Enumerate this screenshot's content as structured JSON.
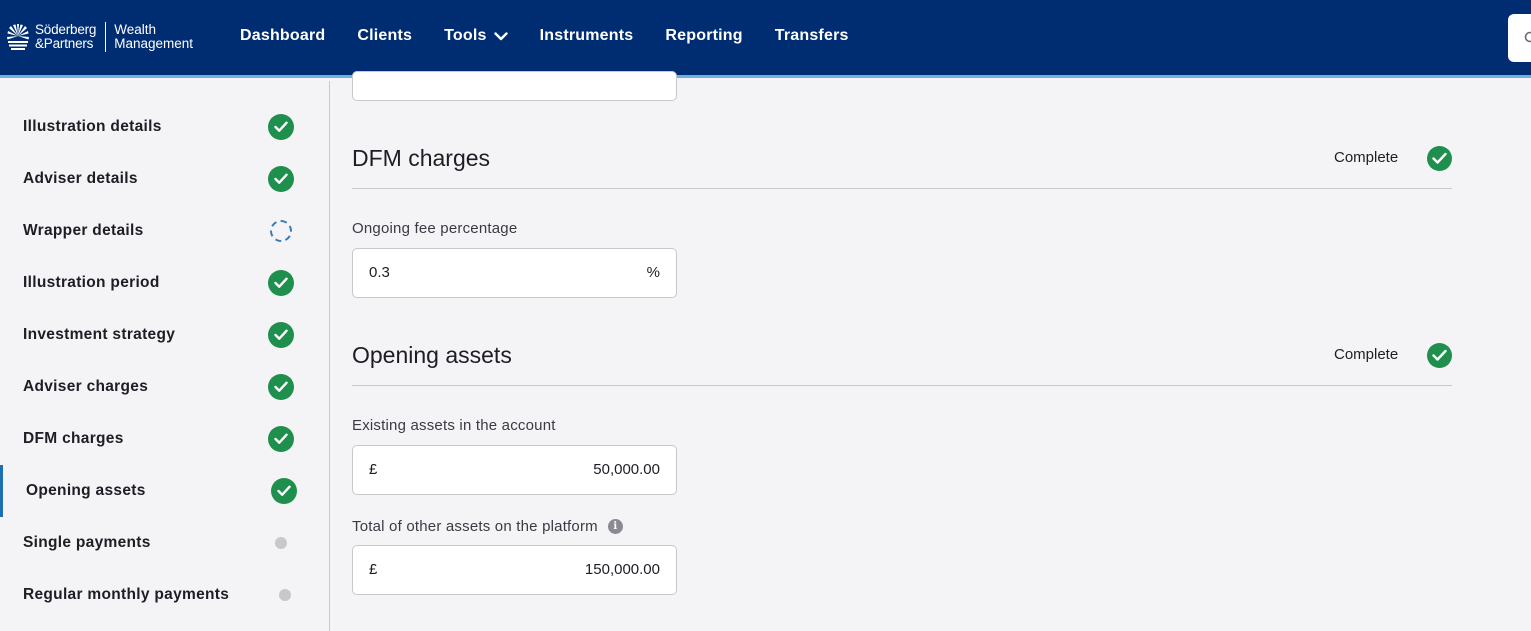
{
  "brand": {
    "name_line1": "Söderberg",
    "name_line2": "&Partners",
    "sub_line1": "Wealth",
    "sub_line2": "Management"
  },
  "nav": {
    "items": [
      {
        "label": "Dashboard"
      },
      {
        "label": "Clients"
      },
      {
        "label": "Tools"
      },
      {
        "label": "Instruments"
      },
      {
        "label": "Reporting"
      },
      {
        "label": "Transfers"
      }
    ]
  },
  "sidebar": {
    "items": [
      {
        "label": "Illustration details",
        "status": "complete"
      },
      {
        "label": "Adviser details",
        "status": "complete"
      },
      {
        "label": "Wrapper details",
        "status": "in-progress"
      },
      {
        "label": "Illustration period",
        "status": "complete"
      },
      {
        "label": "Investment strategy",
        "status": "complete"
      },
      {
        "label": "Adviser charges",
        "status": "complete"
      },
      {
        "label": "DFM charges",
        "status": "complete"
      },
      {
        "label": "Opening assets",
        "status": "complete",
        "active": true
      },
      {
        "label": "Single payments",
        "status": "not-started"
      },
      {
        "label": "Regular monthly payments",
        "status": "not-started"
      }
    ]
  },
  "dfm": {
    "title": "DFM charges",
    "status": "Complete",
    "fee_label": "Ongoing fee percentage",
    "fee_value": "0.3",
    "fee_suffix": "%"
  },
  "opening": {
    "title": "Opening assets",
    "status": "Complete",
    "existing_label": "Existing assets in the account",
    "existing_prefix": "£",
    "existing_value": "50,000.00",
    "other_label": "Total of other assets on the platform",
    "other_prefix": "£",
    "other_value": "150,000.00"
  },
  "colors": {
    "header": "#002d72",
    "complete": "#1f8f4e",
    "active": "#1f6eb3"
  }
}
